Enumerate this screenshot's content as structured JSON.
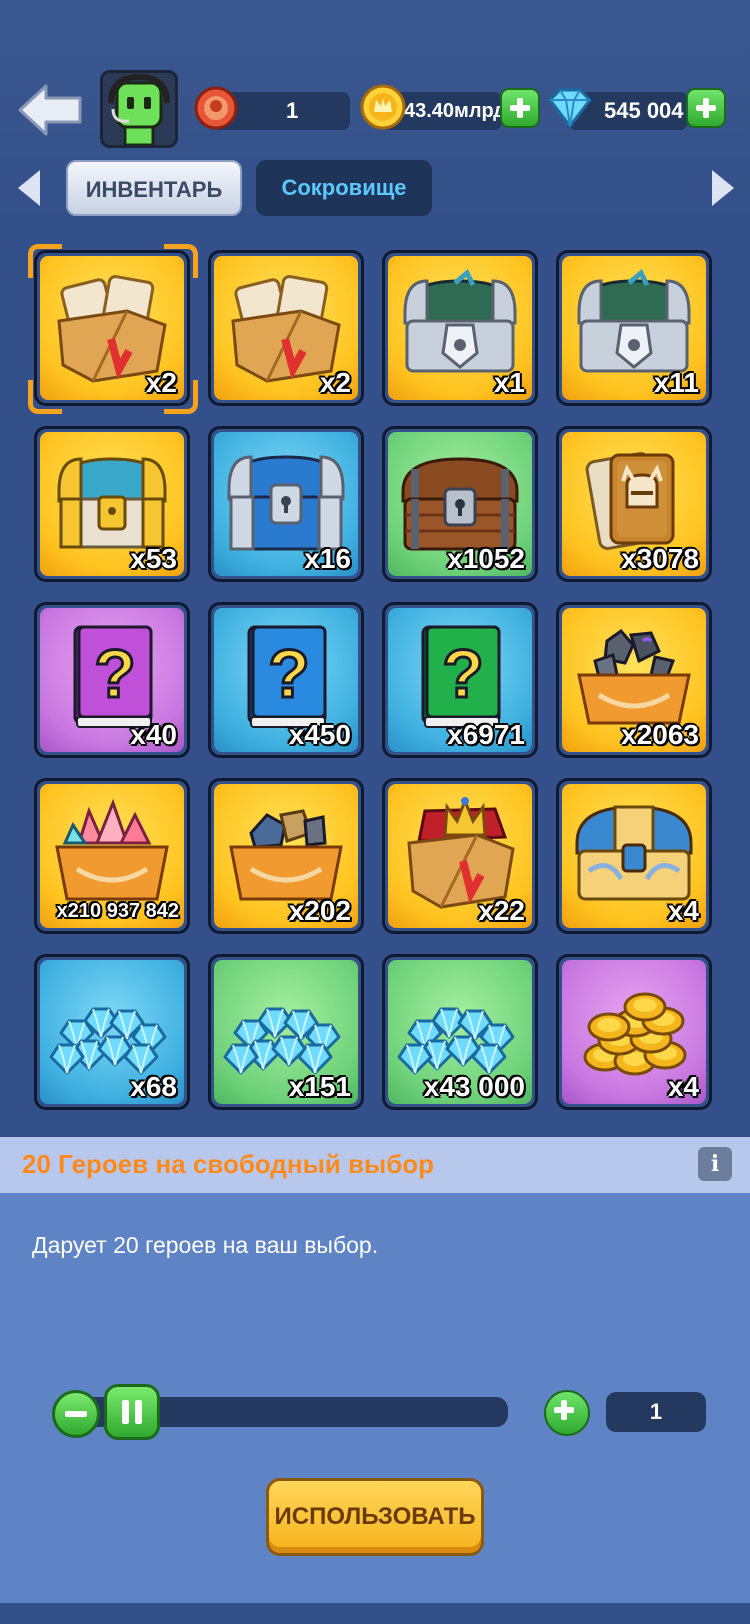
{
  "header": {
    "level_value": "1",
    "gold_value": "43.40млрд",
    "gems_value": "545 004"
  },
  "tabs": {
    "inventory": "ИНВЕНТАРЬ",
    "treasure": "Сокровище"
  },
  "items": [
    {
      "count": "x2",
      "bg": "gold",
      "icon": "hero-card-box-icon"
    },
    {
      "count": "x2",
      "bg": "gold",
      "icon": "hero-card-box-icon"
    },
    {
      "count": "x1",
      "bg": "gold",
      "icon": "silver-chest-icon"
    },
    {
      "count": "x11",
      "bg": "gold",
      "icon": "silver-chest-icon"
    },
    {
      "count": "x53",
      "bg": "gold",
      "icon": "gold-chest-icon"
    },
    {
      "count": "x16",
      "bg": "blue",
      "icon": "blue-chest-icon"
    },
    {
      "count": "x1052",
      "bg": "green",
      "icon": "wooden-chest-icon"
    },
    {
      "count": "x3078",
      "bg": "gold",
      "icon": "hero-card-icon"
    },
    {
      "count": "x40",
      "bg": "purple",
      "icon": "mystery-book-purple-icon"
    },
    {
      "count": "x450",
      "bg": "blue",
      "icon": "mystery-book-blue-icon"
    },
    {
      "count": "x6971",
      "bg": "blue",
      "icon": "mystery-book-green-icon"
    },
    {
      "count": "x2063",
      "bg": "gold",
      "icon": "rune-stones-crate-icon"
    },
    {
      "count": "x210 937 842",
      "bg": "gold",
      "icon": "crystal-crate-icon"
    },
    {
      "count": "x202",
      "bg": "gold",
      "icon": "ore-crate-icon"
    },
    {
      "count": "x22",
      "bg": "gold",
      "icon": "crown-box-icon"
    },
    {
      "count": "x4",
      "bg": "gold",
      "icon": "ornate-chest-icon"
    },
    {
      "count": "x68",
      "bg": "blue",
      "icon": "gem-pile-icon"
    },
    {
      "count": "x151",
      "bg": "green",
      "icon": "gem-pile-icon"
    },
    {
      "count": "x43 000",
      "bg": "green",
      "icon": "gem-pile-icon"
    },
    {
      "count": "x4",
      "bg": "purple",
      "icon": "coin-pile-icon"
    }
  ],
  "detail": {
    "title": "20 Героев на свободный выбор",
    "info": "i",
    "description": "Дарует 20 героев на ваш выбор.",
    "quantity": "1",
    "use_button": "ИСПОЛЬЗОВАТЬ"
  },
  "colors": {
    "background": "#34508a",
    "accent_orange": "#ff8a1c",
    "tab_text": "#5cc8ff"
  }
}
